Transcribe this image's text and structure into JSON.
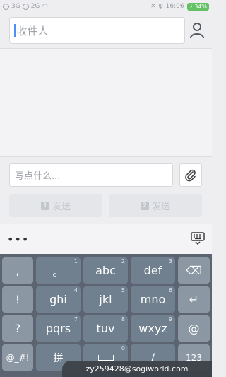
{
  "status_bar": {
    "sim1_type": "3G",
    "sim2_type": "2G",
    "time": "16:06",
    "battery": "34%"
  },
  "recipient": {
    "placeholder": "收件人"
  },
  "composer": {
    "placeholder": "写点什么...",
    "send1_sim": "1",
    "send1_label": "发送",
    "send2_sim": "2",
    "send2_label": "发送"
  },
  "keyboard": {
    "toolbar_more": "•••",
    "rows": [
      [
        {
          "label": ",",
          "sup": ""
        },
        {
          "label": "。",
          "sup": "1"
        },
        {
          "label": "abc",
          "sup": "2"
        },
        {
          "label": "def",
          "sup": "3"
        }
      ],
      [
        {
          "label": "!",
          "sup": ""
        },
        {
          "label": "ghi",
          "sup": "4"
        },
        {
          "label": "jkl",
          "sup": "5"
        },
        {
          "label": "mno",
          "sup": "6"
        }
      ],
      [
        {
          "label": "?",
          "sup": ""
        },
        {
          "label": "pqrs",
          "sup": "7"
        },
        {
          "label": "tuv",
          "sup": "8"
        },
        {
          "label": "wxyz",
          "sup": "9"
        }
      ],
      [
        {
          "label": "@_#!",
          "sup": ""
        },
        {
          "label": "拼",
          "sup": ""
        },
        {
          "label": "",
          "sup": "0"
        },
        {
          "label": "/",
          "sup": ""
        }
      ]
    ],
    "right_keys": [
      {
        "label": "⌫",
        "icon": "backspace-icon"
      },
      {
        "label": "↵",
        "icon": "enter-icon"
      },
      {
        "label": "@",
        "icon": ""
      },
      {
        "label": "123",
        "icon": ""
      }
    ]
  },
  "toast": {
    "text": "zy259428@sogiworld.com"
  }
}
